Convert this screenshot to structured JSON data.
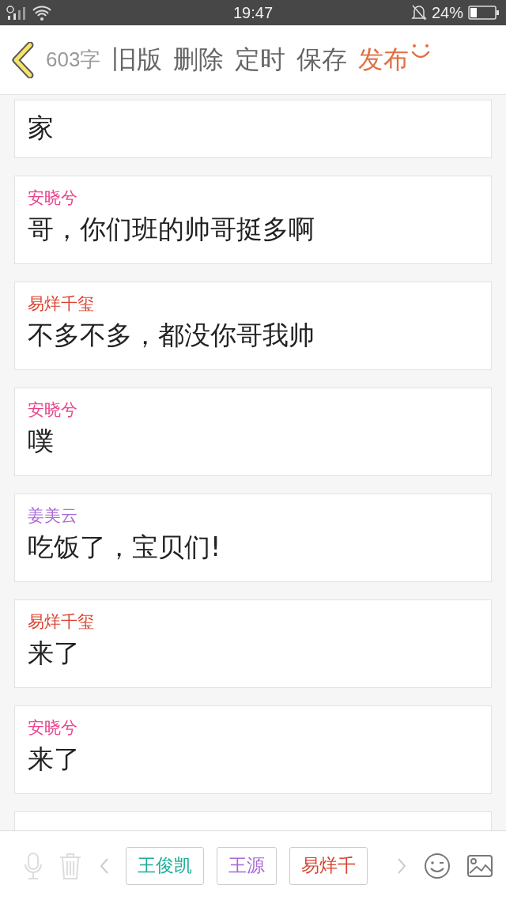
{
  "status_bar": {
    "time": "19:47",
    "battery": "24%"
  },
  "header": {
    "word_count": "603字",
    "actions": [
      {
        "label": "旧版",
        "kind": "plain"
      },
      {
        "label": "删除",
        "kind": "plain"
      },
      {
        "label": "定时",
        "kind": "plain"
      },
      {
        "label": "保存",
        "kind": "plain"
      },
      {
        "label": "发布",
        "kind": "primary"
      }
    ]
  },
  "messages": [
    {
      "text": "家"
    },
    {
      "sender": "安晓兮",
      "color": "#e8458c",
      "text": "哥，你们班的帅哥挺多啊"
    },
    {
      "sender": "易烊千玺",
      "color": "#d9432f",
      "text": "不多不多，都没你哥我帅"
    },
    {
      "sender": "安晓兮",
      "color": "#e8458c",
      "text": "噗"
    },
    {
      "sender": "姜美云",
      "color": "#a86ad6",
      "text": "吃饭了，宝贝们!"
    },
    {
      "sender": "易烊千玺",
      "color": "#d9432f",
      "text": "来了"
    },
    {
      "sender": "安晓兮",
      "color": "#e8458c",
      "text": "来了"
    }
  ],
  "toolbar": {
    "roles": [
      {
        "label": "王俊凯",
        "color": "#1fae9b"
      },
      {
        "label": "王源",
        "color": "#a86ad6"
      },
      {
        "label": "易烊千",
        "color": "#d9432f"
      }
    ]
  }
}
